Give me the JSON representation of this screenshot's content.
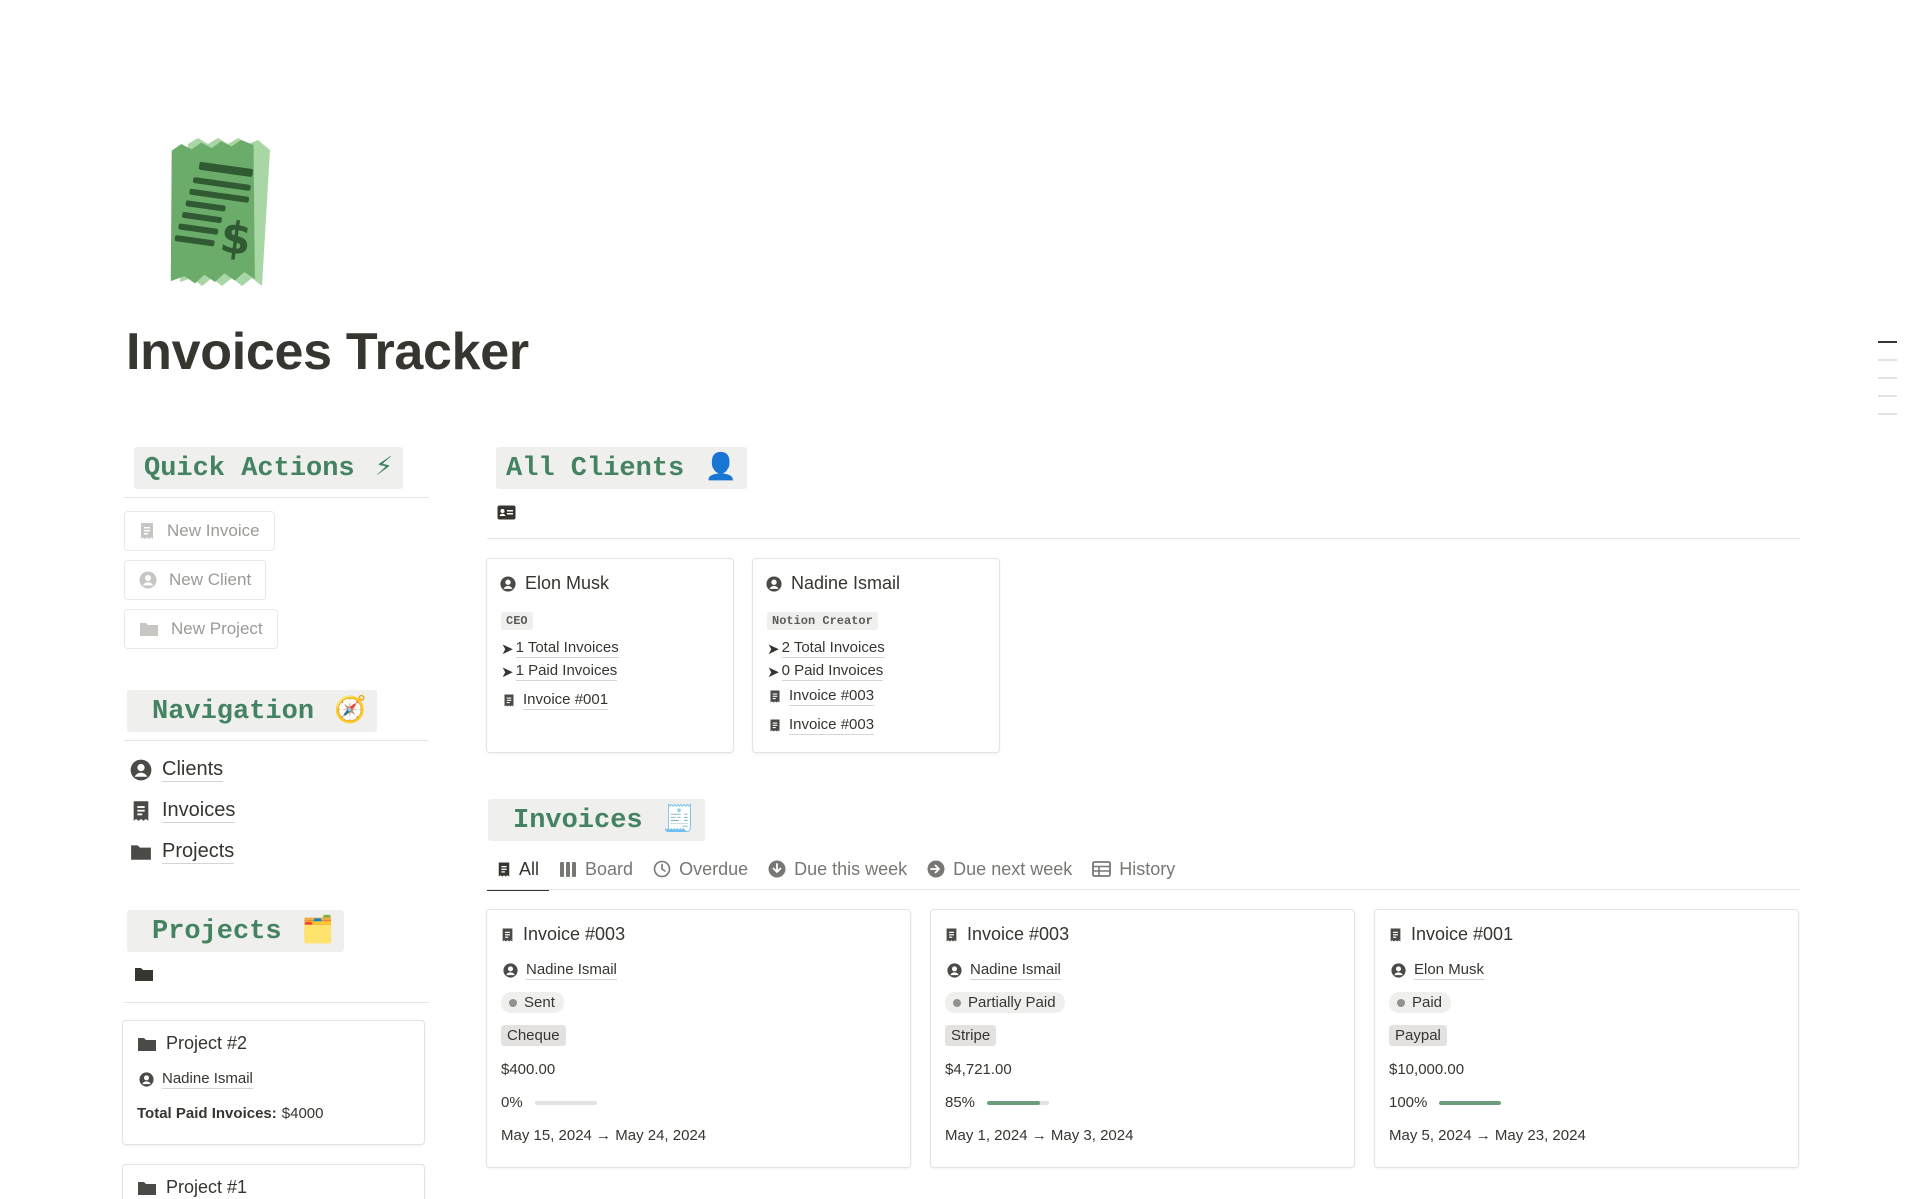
{
  "page": {
    "title": "Invoices Tracker",
    "icon": "receipt-dollar-icon"
  },
  "quick_actions": {
    "heading": "Quick Actions",
    "heading_emoji": "⚡",
    "buttons": [
      {
        "label": "New Invoice",
        "icon": "receipt-icon"
      },
      {
        "label": "New Client",
        "icon": "person-circle-icon"
      },
      {
        "label": "New Project",
        "icon": "folder-icon"
      }
    ]
  },
  "navigation": {
    "heading": "Navigation",
    "heading_emoji": "🧭",
    "items": [
      {
        "label": "Clients",
        "icon": "person-circle-icon"
      },
      {
        "label": "Invoices",
        "icon": "receipt-icon"
      },
      {
        "label": "Projects",
        "icon": "folder-icon"
      }
    ]
  },
  "projects": {
    "heading": "Projects",
    "heading_emoji": "🗂️",
    "cards": [
      {
        "title": "Project #2",
        "client": "Nadine Ismail",
        "total_label": "Total Paid Invoices:",
        "total_value": "$4000"
      },
      {
        "title": "Project #1"
      }
    ]
  },
  "clients": {
    "heading": "All Clients",
    "heading_emoji": "👤",
    "cards": [
      {
        "name": "Elon Musk",
        "role": "CEO",
        "total_invoices": "1 Total Invoices",
        "paid_invoices": "1 Paid Invoices",
        "invoices": [
          "Invoice #001"
        ]
      },
      {
        "name": "Nadine Ismail",
        "role": "Notion Creator",
        "total_invoices": "2 Total Invoices",
        "paid_invoices": "0 Paid Invoices",
        "invoices": [
          "Invoice #003",
          "Invoice #003"
        ]
      }
    ]
  },
  "invoices": {
    "heading": "Invoices",
    "heading_emoji": "🧾",
    "tabs": [
      {
        "label": "All",
        "icon": "receipt-icon",
        "active": true
      },
      {
        "label": "Board",
        "icon": "board-columns-icon"
      },
      {
        "label": "Overdue",
        "icon": "clock-icon"
      },
      {
        "label": "Due this week",
        "icon": "arrow-down-circle-icon"
      },
      {
        "label": "Due next week",
        "icon": "arrow-right-circle-icon"
      },
      {
        "label": "History",
        "icon": "table-icon"
      }
    ],
    "cards": [
      {
        "title": "Invoice #003",
        "client": "Nadine Ismail",
        "status": "Sent",
        "method": "Cheque",
        "amount": "$400.00",
        "progress_label": "0%",
        "progress": 0,
        "dates": "May 15, 2024 → May 24, 2024"
      },
      {
        "title": "Invoice #003",
        "client": "Nadine Ismail",
        "status": "Partially Paid",
        "method": "Stripe",
        "amount": "$4,721.00",
        "progress_label": "85%",
        "progress": 85,
        "dates": "May 1, 2024 → May 3, 2024"
      },
      {
        "title": "Invoice #001",
        "client": "Elon Musk",
        "status": "Paid",
        "method": "Paypal",
        "amount": "$10,000.00",
        "progress_label": "100%",
        "progress": 100,
        "dates": "May 5, 2024 → May 23, 2024"
      }
    ]
  },
  "colors": {
    "heading_green": "#448361",
    "heading_bg": "#efefed",
    "progress_fill": "#6c9b7d",
    "text": "#37352f"
  }
}
